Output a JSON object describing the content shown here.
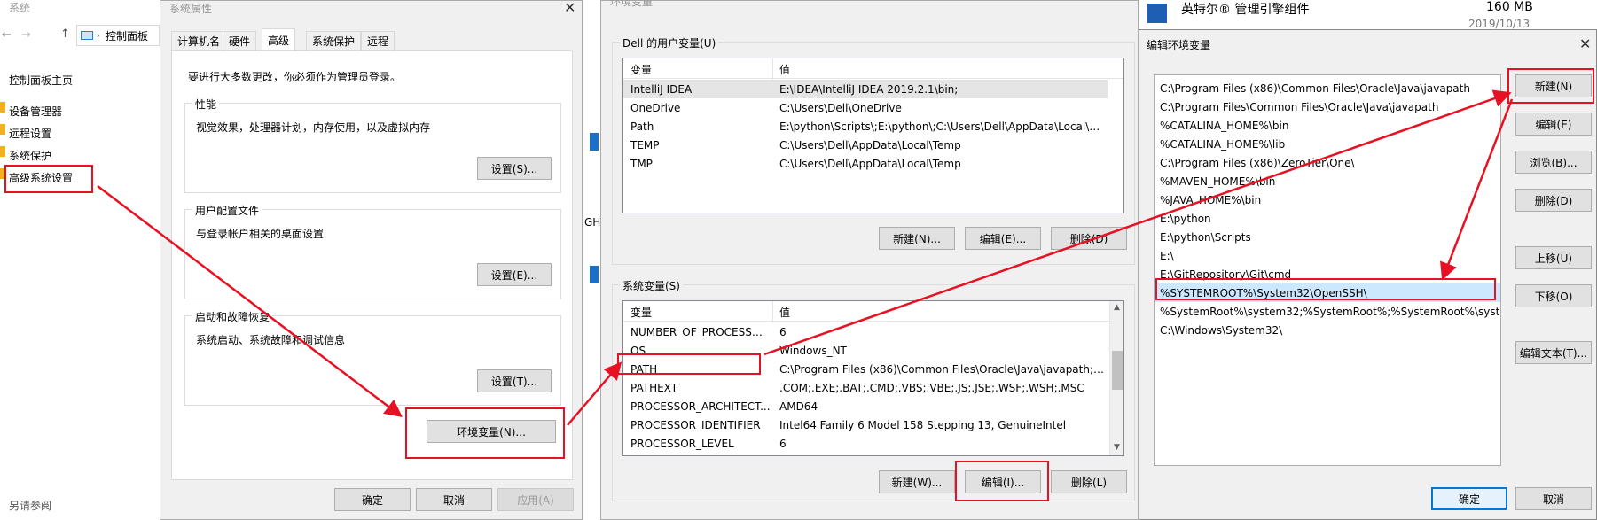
{
  "control_panel": {
    "window_title": "系统",
    "address_text": "控制面板",
    "home_link": "控制面板主页",
    "links": [
      "设备管理器",
      "远程设置",
      "系统保护",
      "高级系统设置"
    ],
    "see_also": "另请参阅",
    "fragment": "GH"
  },
  "sys_props": {
    "title": "系统属性",
    "tabs": [
      "计算机名",
      "硬件",
      "高级",
      "系统保护",
      "远程"
    ],
    "admin_note": "要进行大多数更改，你必须作为管理员登录。",
    "perf_title": "性能",
    "perf_desc": "视觉效果，处理器计划，内存使用，以及虚拟内存",
    "perf_btn": "设置(S)...",
    "profile_title": "用户配置文件",
    "profile_desc": "与登录帐户相关的桌面设置",
    "profile_btn": "设置(E)...",
    "startup_title": "启动和故障恢复",
    "startup_desc": "系统启动、系统故障和调试信息",
    "startup_btn": "设置(T)...",
    "env_btn": "环境变量(N)...",
    "ok": "确定",
    "cancel": "取消",
    "apply": "应用(A)"
  },
  "env_vars": {
    "title": "环境变量",
    "user_group": "Dell 的用户变量(U)",
    "col_var": "变量",
    "col_val": "值",
    "user_rows": [
      {
        "name": "IntelliJ IDEA",
        "value": "E:\\IDEA\\IntelliJ IDEA 2019.2.1\\bin;"
      },
      {
        "name": "OneDrive",
        "value": "C:\\Users\\Dell\\OneDrive"
      },
      {
        "name": "Path",
        "value": "E:\\python\\Scripts\\;E:\\python\\;C:\\Users\\Dell\\AppData\\Local\\Mi..."
      },
      {
        "name": "TEMP",
        "value": "C:\\Users\\Dell\\AppData\\Local\\Temp"
      },
      {
        "name": "TMP",
        "value": "C:\\Users\\Dell\\AppData\\Local\\Temp"
      }
    ],
    "user_new": "新建(N)...",
    "user_edit": "编辑(E)...",
    "user_delete": "删除(D)",
    "sys_group": "系统变量(S)",
    "sys_rows": [
      {
        "name": "NUMBER_OF_PROCESSORS",
        "value": "6"
      },
      {
        "name": "OS",
        "value": "Windows_NT"
      },
      {
        "name": "PATH",
        "value": "C:\\Program Files (x86)\\Common Files\\Oracle\\Java\\javapath;C:..."
      },
      {
        "name": "PATHEXT",
        "value": ".COM;.EXE;.BAT;.CMD;.VBS;.VBE;.JS;.JSE;.WSF;.WSH;.MSC"
      },
      {
        "name": "PROCESSOR_ARCHITECT...",
        "value": "AMD64"
      },
      {
        "name": "PROCESSOR_IDENTIFIER",
        "value": "Intel64 Family 6 Model 158 Stepping 13, GenuineIntel"
      },
      {
        "name": "PROCESSOR_LEVEL",
        "value": "6"
      }
    ],
    "sys_new": "新建(W)...",
    "sys_edit": "编辑(I)...",
    "sys_delete": "删除(L)"
  },
  "background_app": {
    "name": "英特尔® 管理引擎组件",
    "size": "160 MB",
    "date": "2019/10/13"
  },
  "edit_env": {
    "title": "编辑环境变量",
    "entries": [
      "C:\\Program Files (x86)\\Common Files\\Oracle\\Java\\javapath",
      "C:\\Program Files\\Common Files\\Oracle\\Java\\javapath",
      "%CATALINA_HOME%\\bin",
      "%CATALINA_HOME%\\lib",
      "C:\\Program Files (x86)\\ZeroTier\\One\\",
      "%MAVEN_HOME%\\bin",
      "%JAVA_HOME%\\bin",
      "E:\\python",
      "E:\\python\\Scripts",
      "E:\\",
      "E:\\GitRepository\\Git\\cmd",
      "%SYSTEMROOT%\\System32\\OpenSSH\\",
      "%SystemRoot%\\system32;%SystemRoot%;%SystemRoot%\\syst...",
      "C:\\Windows\\System32\\"
    ],
    "btn_new": "新建(N)",
    "btn_edit": "编辑(E)",
    "btn_browse": "浏览(B)...",
    "btn_delete": "删除(D)",
    "btn_up": "上移(U)",
    "btn_down": "下移(O)",
    "btn_edit_text": "编辑文本(T)...",
    "ok": "确定",
    "cancel": "取消"
  },
  "colors": {
    "highlight": "#e81123",
    "focus": "#0078d7"
  }
}
